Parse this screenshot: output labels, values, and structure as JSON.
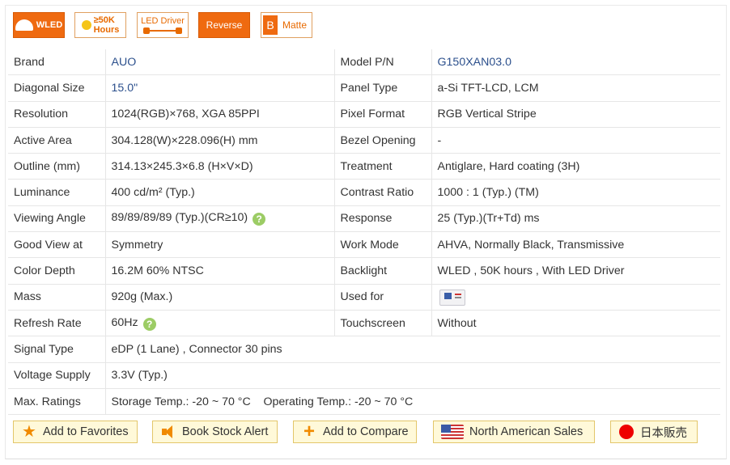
{
  "badges": {
    "wled": "WLED",
    "hours_line1": "≥50K",
    "hours_line2": "Hours",
    "led_driver": "LED Driver",
    "reverse": "Reverse",
    "matte_letter": "B",
    "matte": "Matte"
  },
  "spec_rows": [
    {
      "k1": "Brand",
      "v1": "AUO",
      "k2": "Model P/N",
      "v2": "G150XAN03.0"
    },
    {
      "k1": "Diagonal Size",
      "v1": "15.0\"",
      "k2": "Panel Type",
      "v2": "a-Si TFT-LCD, LCM"
    },
    {
      "k1": "Resolution",
      "v1": "1024(RGB)×768, XGA  85PPI",
      "k2": "Pixel Format",
      "v2": "RGB Vertical Stripe"
    },
    {
      "k1": "Active Area",
      "v1": "304.128(W)×228.096(H) mm",
      "k2": "Bezel Opening",
      "v2": "-"
    },
    {
      "k1": "Outline (mm)",
      "v1": "314.13×245.3×6.8 (H×V×D)",
      "k2": "Treatment",
      "v2": "Antiglare, Hard coating (3H)"
    },
    {
      "k1": "Luminance",
      "v1": "400 cd/m² (Typ.)",
      "k2": "Contrast Ratio",
      "v2": "1000 : 1 (Typ.) (TM)"
    },
    {
      "k1": "Viewing Angle",
      "v1": "89/89/89/89 (Typ.)(CR≥10)",
      "k2": "Response",
      "v2": "25 (Typ.)(Tr+Td) ms"
    },
    {
      "k1": "Good View at",
      "v1": "Symmetry",
      "k2": "Work Mode",
      "v2": "AHVA, Normally Black, Transmissive"
    },
    {
      "k1": "Color Depth",
      "v1": "16.2M   60% NTSC",
      "k2": "Backlight",
      "v2": "WLED , 50K hours , With LED Driver"
    },
    {
      "k1": "Mass",
      "v1": "920g (Max.)",
      "k2": "Used for",
      "v2": ""
    },
    {
      "k1": "Refresh Rate",
      "v1": "60Hz",
      "k2": "Touchscreen",
      "v2": "Without"
    }
  ],
  "wide_rows": [
    {
      "k": "Signal Type",
      "v": "eDP (1 Lane) , Connector 30 pins"
    },
    {
      "k": "Voltage Supply",
      "v": "3.3V (Typ.)"
    },
    {
      "k": "Max. Ratings",
      "v": "Storage Temp.: -20 ~ 70 °C    Operating Temp.: -20 ~ 70 °C"
    }
  ],
  "help_icon": "?",
  "actions": {
    "favorites": "Add to Favorites",
    "stock_alert": "Book Stock Alert",
    "compare": "Add to Compare",
    "na_sales": "North American Sales",
    "jp_sales": "日本販売"
  }
}
